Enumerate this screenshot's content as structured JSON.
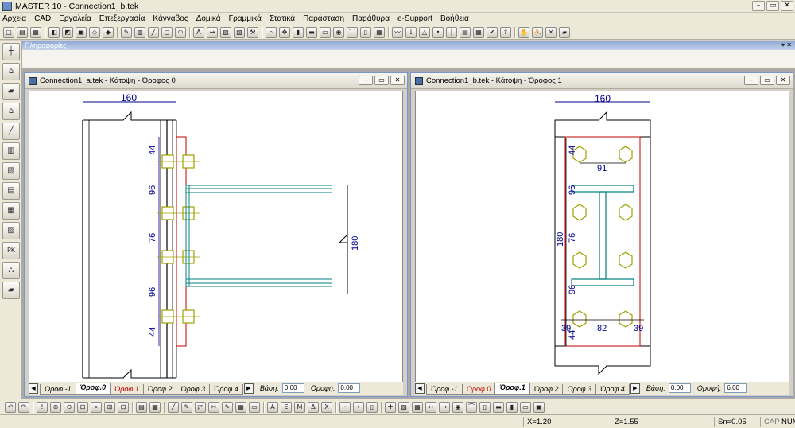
{
  "app": {
    "title": "MASTER 10 - Connection1_b.tek"
  },
  "menu": [
    "Αρχεία",
    "CAD",
    "Εργαλεία",
    "Επεξεργασία",
    "Κάνναβος",
    "Δομικά",
    "Γραμμικά",
    "Στατικά",
    "Παράσταση",
    "Παράθυρα",
    "e-Support",
    "Βοήθεια"
  ],
  "toolbar_icons": [
    "new-icon",
    "open-icon",
    "save-icon",
    "print-icon",
    "copy-icon",
    "paste-icon",
    "undo-icon",
    "redo-icon",
    "select-icon",
    "grid-icon",
    "line-icon",
    "circle-icon",
    "arc-icon",
    "text-icon",
    "dimension-icon",
    "hatch-icon",
    "layer-icon",
    "tools-icon",
    "zoom-icon",
    "pan-icon",
    "column-icon",
    "beam-icon",
    "plate-icon",
    "bolt-icon",
    "weld-icon",
    "section-icon",
    "table-icon",
    "wire-icon",
    "load-icon",
    "support-icon",
    "node-icon",
    "member-icon",
    "report-icon",
    "calc-icon",
    "check-icon",
    "export-icon",
    "hand-icon",
    "walk-icon",
    "delete-icon",
    "book-icon"
  ],
  "left_tools": [
    "axis-icon",
    "frame-icon",
    "floor-icon",
    "building-icon",
    "stairs-icon",
    "chart-icon",
    "walls-icon",
    "layers-icon",
    "calculator-icon",
    "report-icon",
    "pk-icon",
    "structure-icon",
    "book-icon"
  ],
  "info": {
    "title": "Πληροφορίες"
  },
  "window_a": {
    "title": "Connection1_a.tek - Κάτοψη - Όροφος 0",
    "dims": {
      "top": "160",
      "d1": "44",
      "d2": "96",
      "d3": "76",
      "d4": "96",
      "d5": "44",
      "right": "180"
    },
    "tabs": [
      "Όροφ.-1",
      "Όροφ.0",
      "Όροφ.1",
      "Όροφ.2",
      "Όροφ.3",
      "Όροφ.4"
    ],
    "active_tab": 1,
    "base_label": "Βάση:",
    "base_value": "0.00",
    "roof_label": "Οροφή:",
    "roof_value": "0.00"
  },
  "window_b": {
    "title": "Connection1_b.tek - Κάτοψη - Όροφος 1",
    "dims": {
      "top": "160",
      "d1": "44",
      "d2": "96",
      "d3": "76",
      "d4": "96",
      "d5": "44",
      "left": "180",
      "inner": "91",
      "b1": "39",
      "b2": "82",
      "b3": "39"
    },
    "tabs": [
      "Όροφ.-1",
      "Όροφ.0",
      "Όροφ.1",
      "Όροφ.2",
      "Όροφ.3",
      "Όροφ.4"
    ],
    "active_tab": 2,
    "base_label": "Βάση:",
    "base_value": "0.00",
    "roof_label": "Οροφή:",
    "roof_value": "6.00"
  },
  "bottom_icons": [
    "undo-icon",
    "redo-icon",
    "alert-icon",
    "zoom-in-icon",
    "zoom-out-icon",
    "zoom-window-icon",
    "zoom-prev-icon",
    "zoom-all-icon",
    "zoom-fit-icon",
    "layer-icon",
    "view-icon",
    "line-icon",
    "pen-icon",
    "select-icon",
    "trim-icon",
    "edit-icon",
    "table-icon",
    "window-icon",
    "text-a-icon",
    "text-e-icon",
    "text-m-icon",
    "text-delta-icon",
    "text-x-icon",
    "dot-icon",
    "snap-icon",
    "mouse-icon",
    "cross-icon",
    "hatch-icon",
    "grid-icon",
    "dim-icon",
    "arrow-icon",
    "bolt-icon",
    "weld-icon",
    "section-icon",
    "beam-icon",
    "column-icon",
    "plate-icon",
    "end-icon"
  ],
  "status": {
    "x": "X=1.20",
    "z": "Z=1.55",
    "sn": "Sn=0.05",
    "caps": "CAP",
    "num": "NUM"
  },
  "colors": {
    "dim": "#00008b",
    "bolt": "#a0a000",
    "plate": "#c00000",
    "profile": "#008080"
  }
}
